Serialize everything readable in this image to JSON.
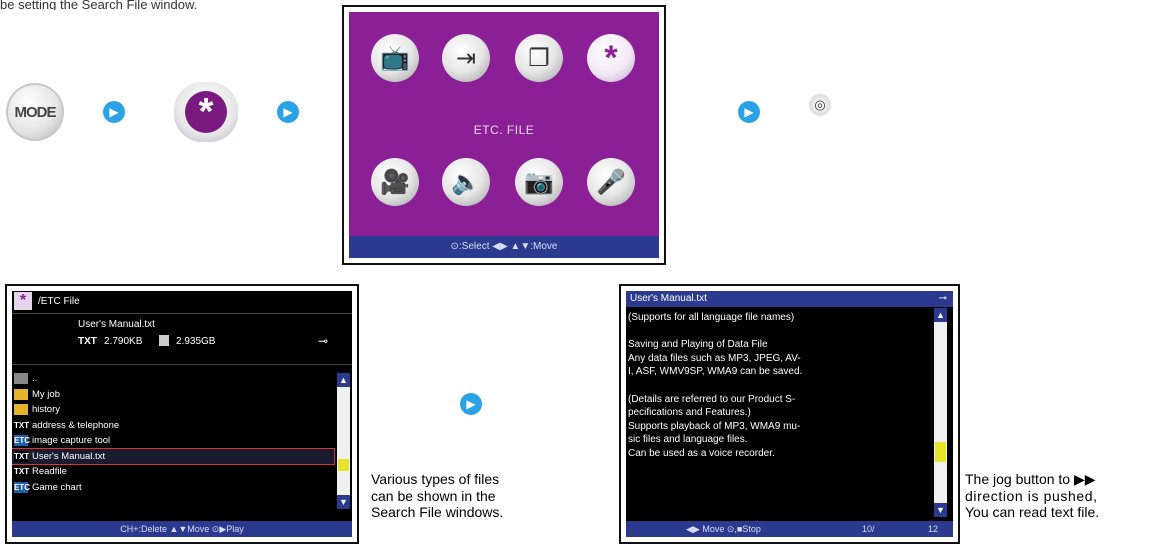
{
  "top_text": "be setting the Search File window.",
  "mode_button": {
    "label": "MODE"
  },
  "arrow_glyph": "▶",
  "menu": {
    "label": "ETC. FILE",
    "footer": "⊙:Select  ◀▶ ▲▼:Move",
    "icons": [
      "tv-icon",
      "input-icon",
      "file-icon",
      "star-icon",
      "video-icon",
      "speaker-icon",
      "camera-icon",
      "microphone-icon"
    ],
    "selected_icon": "star-icon"
  },
  "jog_icon_glyph": "◎",
  "file_browser": {
    "path": "/ETC File",
    "file_name": "User's Manual.txt",
    "file_type": "TXT",
    "file_size": "2.790KB",
    "storage": "2.935GB",
    "items": [
      {
        "type": "up",
        "label": ".."
      },
      {
        "type": "folder",
        "label": "My job"
      },
      {
        "type": "folder",
        "label": "history"
      },
      {
        "type": "txt",
        "label": "address & telephone"
      },
      {
        "type": "etc",
        "label": "image capture tool"
      },
      {
        "type": "txt",
        "label": "User's Manual.txt",
        "selected": true
      },
      {
        "type": "txt",
        "label": "Readfile"
      },
      {
        "type": "etc",
        "label": "Game chart"
      }
    ],
    "type_badges": {
      "txt": "TXT",
      "etc": "ETC",
      "folder": "",
      "up": ""
    },
    "footer": "CH+:Delete  ▲▼Move  ⊙▶Play"
  },
  "caption_left": [
    "Various types of files",
    "can be shown in the",
    "Search File windows."
  ],
  "text_viewer": {
    "title": "User's Manual.txt",
    "lines": [
      "(Supports for all language file names)",
      "",
      "Saving and Playing of Data File",
      "Any data files such as MP3, JPEG, AV-",
      "I, ASF, WMV9SP, WMA9 can be saved.",
      "",
      "(Details are referred to our Product S-",
      "pecifications and Features.)",
      "Supports playback of MP3, WMA9 mu-",
      "sic files and language files.",
      "Can be used as a voice recorder."
    ],
    "footer_left": "◀▶ Move ⊙,■Stop",
    "page": "10/",
    "total": "12"
  },
  "caption_right": [
    "The jog button to ▶▶",
    "direction is pushed,",
    "You can read text file."
  ],
  "colors": {
    "menu_bg": "#8b2096",
    "bar_blue": "#2b3a8f",
    "arrow_blue": "#2aa3e6",
    "scroll_thumb": "#e8e32b"
  }
}
